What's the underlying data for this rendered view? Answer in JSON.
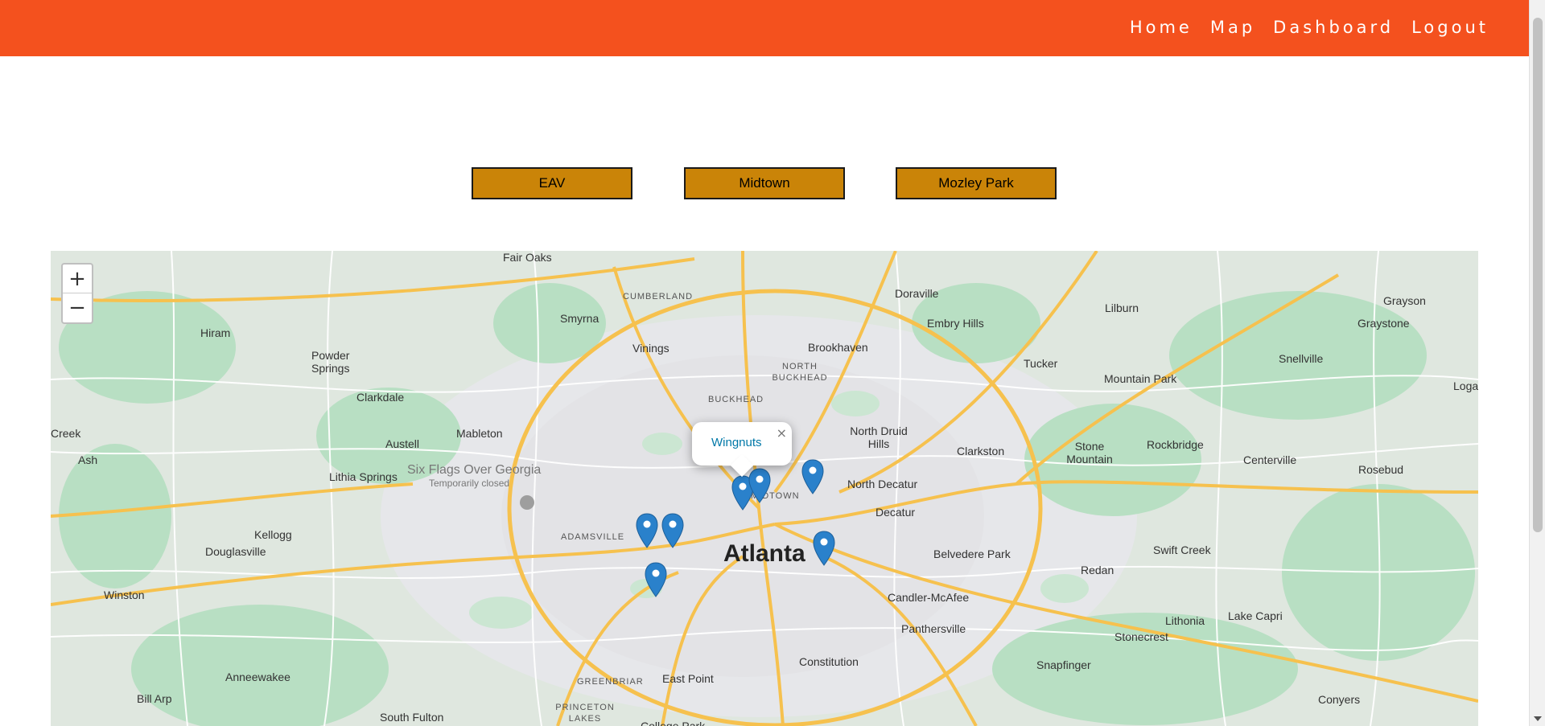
{
  "header": {
    "nav": [
      "Home",
      "Map",
      "Dashboard",
      "Logout"
    ]
  },
  "buttons": [
    "EAV",
    "Midtown",
    "Mozley Park"
  ],
  "map": {
    "zoom_in": "+",
    "zoom_out": "−",
    "popup": {
      "name": "Wingnuts",
      "close": "×"
    },
    "labels": {
      "fair_oaks": "Fair Oaks",
      "cumberland": "CUMBERLAND",
      "doraville": "Doraville",
      "grayson": "Grayson",
      "graystone": "Graystone",
      "lilburn": "Lilburn",
      "embry_hills": "Embry Hills",
      "smyrna": "Smyrna",
      "hiram": "Hiram",
      "powder_springs": "Powder Springs",
      "vinings": "Vinings",
      "brookhaven": "Brookhaven",
      "north_buckhead": "NORTH BUCKHEAD",
      "tucker": "Tucker",
      "snellville": "Snellville",
      "clarkdale": "Clarkdale",
      "buckhead": "BUCKHEAD",
      "mountain_park": "Mountain Park",
      "loganville": "Loga",
      "creek": "Creek",
      "ash": "Ash",
      "mableton": "Mableton",
      "austell": "Austell",
      "north_druid_hills": "North Druid Hills",
      "clarkston": "Clarkston",
      "stone_mountain": "Stone Mountain",
      "rockbridge": "Rockbridge",
      "centerville": "Centerville",
      "rosebud": "Rosebud",
      "lithia_springs": "Lithia Springs",
      "six_flags": "Six Flags Over Georgia",
      "temp_closed": "Temporarily closed",
      "midtown": "MIDTOWN",
      "north_decatur": "North Decatur",
      "kellogg": "Kellogg",
      "decatur": "Decatur",
      "douglasville": "Douglasville",
      "adamsville": "ADAMSVILLE",
      "atlanta": "Atlanta",
      "belvedere_park": "Belvedere Park",
      "swift_creek": "Swift Creek",
      "redan": "Redan",
      "winston": "Winston",
      "candler_mcafee": "Candler-McAfee",
      "panthersville": "Panthersville",
      "lithonia": "Lithonia",
      "lake_capri": "Lake Capri",
      "stonecrest": "Stonecrest",
      "east_point": "East Point",
      "constitution": "Constitution",
      "snapfinger": "Snapfinger",
      "anneewakee": "Anneewakee",
      "bill_arp": "Bill Arp",
      "greenbriar": "GREENBRIAR",
      "princeton_lakes": "PRINCETON LAKES",
      "south_fulton": "South Fulton",
      "college_park": "College Park",
      "conyers": "Conyers"
    },
    "colors": {
      "land": "#e9eaed",
      "green": "#b3dfc0",
      "highway": "#f6c14e",
      "marker": "#2a81cb",
      "header": "#f4511e",
      "button": "#ca8408"
    }
  }
}
